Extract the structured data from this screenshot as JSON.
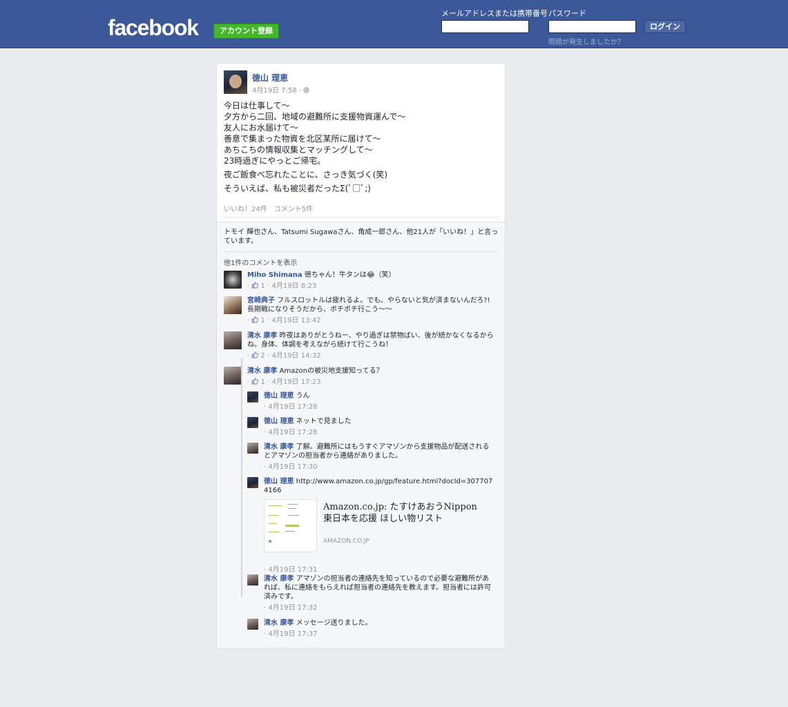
{
  "header": {
    "logo": "facebook",
    "signup_label": "アカウント登録",
    "email_label": "メールアドレスまたは携帯番号",
    "password_label": "パスワード",
    "login_label": "ログイン",
    "forgot_label": "問題が発生しましたか？"
  },
  "post": {
    "author": "徳山 理恵",
    "timestamp": "4月19日 7:58 · ",
    "privacy_icon": "globe-icon",
    "paragraphs": [
      "今日は仕事して〜\n夕方から二回、地域の避難所に支援物資運んで〜\n友人にお水届けて〜\n善意で集まった物資を北区某所に届けて〜\nあちこちの情報収集とマッチングして〜\n23時過ぎにやっとご帰宅。",
      "夜ご飯食べ忘れたことに、さっき気づく(笑)",
      "そういえば、私も被災者だったΣ(ﾟ□ﾟ;)"
    ],
    "stats": "いいね！24件　コメント5件",
    "likes_summary": "トモイ 輝也さん、Tatsumi Sugawaさん、角成一郎さん、他21人が「いいね！」と言っています。",
    "more_comments": "他1件のコメントを表示"
  },
  "comments": [
    {
      "name": "Miho Shimana",
      "text": "徳ちゃん！牛タンは😂（笑）",
      "likes": "1",
      "time": "4月19日 8:23"
    },
    {
      "name": "宮崎典子",
      "text": "フルスロットルは疲れるよ。でも、やらないと気が済まないんだろ?!長期戦になりそうだから、ボチボチ行こう〜〜",
      "likes": "1",
      "time": "4月19日 13:42"
    },
    {
      "name": "清水 康孝",
      "text": "昨夜はありがとうねー、やり過ぎは禁物ばい、後が続かなくなるからね。身体、体調を考えながら続けて行こうね！",
      "likes": "2",
      "time": "4月19日 14:32"
    },
    {
      "name": "清水 康孝",
      "text": "Amazonの被災地支援知ってる？",
      "likes": "1",
      "time": "4月19日 17:23"
    }
  ],
  "replies": [
    {
      "name": "徳山 理恵",
      "text": "うん",
      "time": "· 4月19日 17:28"
    },
    {
      "name": "徳山 理恵",
      "text": "ネットで見ました",
      "time": "· 4月19日 17:28"
    },
    {
      "name": "清水 康孝",
      "text": "了解。避難所にはもうすぐアマゾンから支援物品が配送されるとアマゾンの担当者から連絡がありました。",
      "time": "· 4月19日 17:30"
    },
    {
      "name": "徳山 理恵",
      "text": "http://www.amazon.co.jp/gp/feature.html?docId=3077074166",
      "time": "· 4月19日 17:31",
      "link": {
        "title": "Amazon.co.jp: たすけあおうNippon 東日本を応援 ほしい物リスト",
        "domain": "AMAZON.CO.JP"
      }
    },
    {
      "name": "清水 康孝",
      "text": "アマゾンの担当者の連絡先を知っているので必要な避難所があれば、私に連絡をもらえれば担当者の連絡先を教えます。担当者には許可済みです。",
      "time": "· 4月19日 17:32"
    },
    {
      "name": "清水 康孝",
      "text": "メッセージ送りました。",
      "time": "· 4月19日 17:37"
    }
  ],
  "colors": {
    "brand": "#3b5998",
    "link": "#365899",
    "signup": "#42b72a"
  }
}
